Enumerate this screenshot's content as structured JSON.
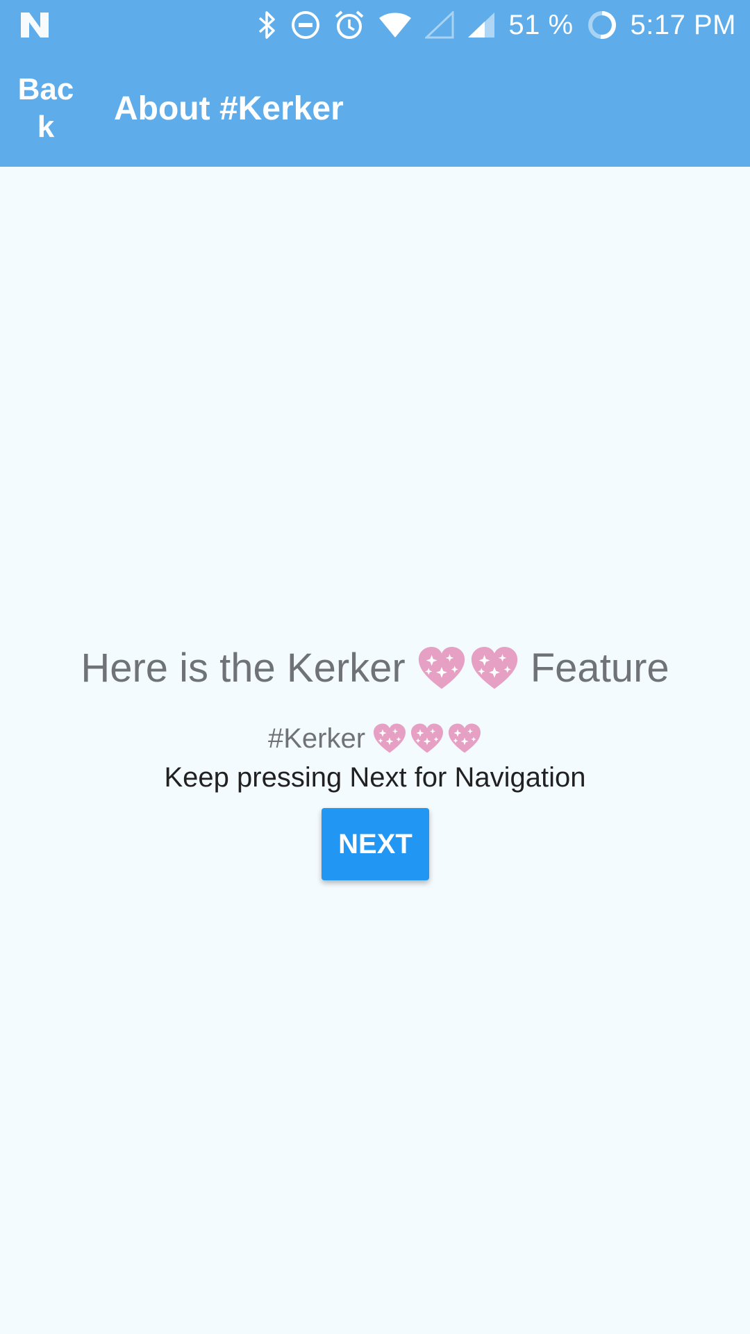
{
  "status_bar": {
    "battery_percent": "51 %",
    "time": "5:17 PM",
    "icons": [
      "notification-n-icon",
      "bluetooth-icon",
      "do-not-disturb-icon",
      "alarm-icon",
      "wifi-icon",
      "signal-empty-icon",
      "signal-icon",
      "battery-ring-icon"
    ]
  },
  "toolbar": {
    "back_label": "Back",
    "title": "About #Kerker"
  },
  "main": {
    "headline_prefix": "Here is the Kerker",
    "headline_suffix": "Feature",
    "hashtag": "#Kerker",
    "instruction": "Keep pressing Next for Navigation",
    "next_label": "NEXT"
  },
  "colors": {
    "app_bar": "#5eadea",
    "background": "#f4fbff",
    "button": "#2196f3",
    "heart": "#e5a0c4"
  }
}
